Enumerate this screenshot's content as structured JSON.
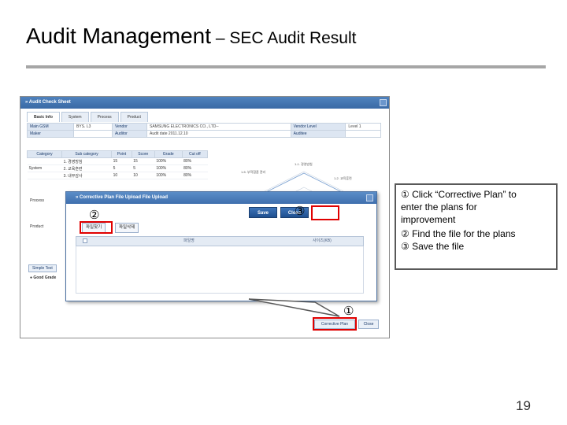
{
  "slide": {
    "title_main": "Audit Management",
    "title_sub": " – SEC Audit Result",
    "page_number": "19"
  },
  "window": {
    "title": "» Audit Check Sheet",
    "tabs": [
      "Basic Info",
      "System",
      "Process",
      "Product"
    ]
  },
  "info": {
    "main_gsm_label": "Main GSM",
    "main_gsm_value": "BYS. L3",
    "vendor_label": "Vendor",
    "vendor_value": "SAMSUNG ELECTRONICS CO., LTD--",
    "vendor_level_label": "Vendor Level",
    "vendor_level_value": "Level 1",
    "maker_label": "Maker",
    "auditor_label": "Auditor",
    "audit_date_label": "Audit date",
    "audit_date_value": "2011.12.10",
    "auditee_label": "Auditee"
  },
  "category_table": {
    "headers": [
      "Category",
      "Sub category",
      "Point",
      "Score",
      "Grade",
      "Cut off"
    ],
    "rows": [
      [
        "",
        "1. 경영방침",
        "15",
        "15",
        "100%",
        "80%"
      ],
      [
        "System",
        "2. 교육훈련",
        "5",
        "5",
        "100%",
        "80%"
      ],
      [
        "",
        "3. 내부감사",
        "10",
        "10",
        "100%",
        "80%"
      ]
    ],
    "side_labels": [
      "Process",
      "Product"
    ]
  },
  "radar": {
    "labels": [
      "1-1. 경영방침",
      "1-5. 부적합품 관리",
      "1-2. 교육훈련"
    ]
  },
  "bottom": {
    "simple_btn": "Simple Test",
    "good_label": "● Good Grade"
  },
  "dialog": {
    "title": "» Corrective Plan File Upload File Upload",
    "save_label": "Save",
    "close_label": "Close",
    "file_select_label": "파일찾기",
    "file_delete_label": "파일삭제",
    "col_filename": "파일명",
    "col_size": "사이즈(KB)"
  },
  "footer_buttons": {
    "corrective_plan": "Corrective Plan",
    "close": "Close"
  },
  "annotations": {
    "markers": [
      "①",
      "②",
      "③"
    ],
    "callout_lines": [
      "① Click “Corrective Plan” to",
      "   enter the plans for",
      "   improvement",
      "② Find the file for the plans",
      "③ Save the file"
    ]
  },
  "colors": {
    "highlight": "#e00000",
    "title_bar": "#3a6aa5",
    "rule": "#a6a6a6"
  }
}
